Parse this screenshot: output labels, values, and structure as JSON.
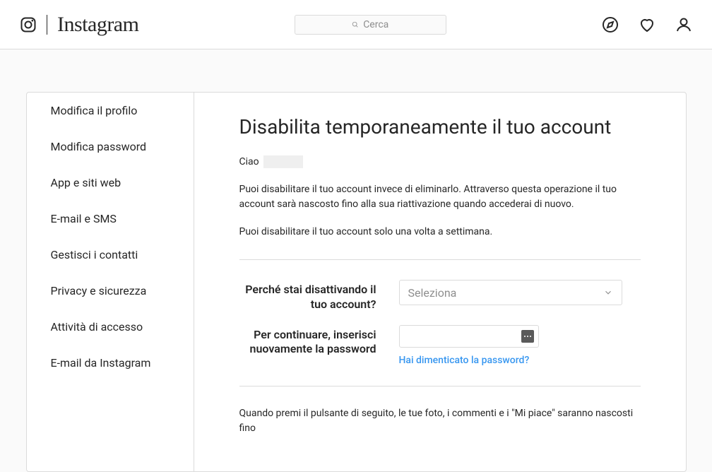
{
  "header": {
    "wordmark": "Instagram",
    "search_placeholder": "Cerca"
  },
  "sidebar": {
    "items": [
      {
        "label": "Modifica il profilo"
      },
      {
        "label": "Modifica password"
      },
      {
        "label": "App e siti web"
      },
      {
        "label": "E-mail e SMS"
      },
      {
        "label": "Gestisci i contatti"
      },
      {
        "label": "Privacy e sicurezza"
      },
      {
        "label": "Attività di accesso"
      },
      {
        "label": "E-mail da Instagram"
      }
    ]
  },
  "main": {
    "title": "Disabilita temporaneamente il tuo account",
    "greeting_prefix": "Ciao",
    "paragraph1": "Puoi disabilitare il tuo account invece di eliminarlo. Attraverso questa operazione il tuo account sarà nascosto fino alla sua riattivazione quando accederai di nuovo.",
    "paragraph2": "Puoi disabilitare il tuo account solo una volta a settimana.",
    "reason_label": "Perché stai disattivando il tuo account?",
    "reason_placeholder": "Seleziona",
    "password_label": "Per continuare, inserisci nuovamente la password",
    "forgot_password": "Hai dimenticato la password?",
    "paragraph3": "Quando premi il pulsante di seguito, le tue foto, i commenti e i \"Mi piace\" saranno nascosti fino"
  }
}
